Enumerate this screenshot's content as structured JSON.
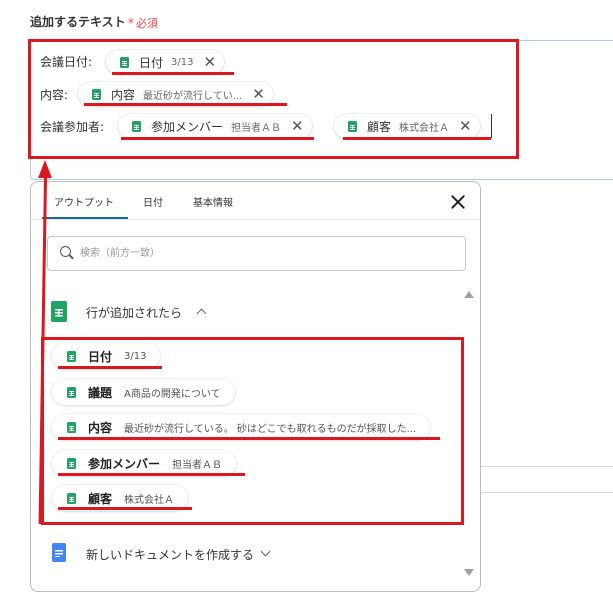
{
  "form": {
    "label": "追加するテキスト",
    "required_mark": "*",
    "required_text": "必須",
    "rows": [
      {
        "label": "会議日付:",
        "chips": [
          {
            "name": "日付",
            "value": "3/13"
          }
        ]
      },
      {
        "label": "内容:",
        "chips": [
          {
            "name": "内容",
            "value": "最近砂が流行してい..."
          }
        ]
      },
      {
        "label": "会議参加者:",
        "chips": [
          {
            "name": "参加メンバー",
            "value": "担当者ＡＢ"
          },
          {
            "name": "顧客",
            "value": "株式会社Ａ"
          }
        ]
      }
    ]
  },
  "panel": {
    "tabs": [
      "アウトプット",
      "日付",
      "基本情報"
    ],
    "active_tab": "アウトプット",
    "search_placeholder": "検索（前方一致）",
    "group": {
      "title": "行が追加されたら",
      "items": [
        {
          "name": "日付",
          "value": "3/13"
        },
        {
          "name": "議題",
          "value": "A商品の開発について"
        },
        {
          "name": "内容",
          "value": "最近砂が流行している。 砂はどこでも取れるものだが採取した..."
        },
        {
          "name": "参加メンバー",
          "value": "担当者ＡＢ"
        },
        {
          "name": "顧客",
          "value": "株式会社Ａ"
        }
      ]
    },
    "next_group": {
      "title": "新しいドキュメントを作成する"
    }
  },
  "colors": {
    "annotation_red": "#d9191f",
    "sheets_green": "#1fa463",
    "docs_blue": "#4285f4",
    "tab_active": "#1a6e8a",
    "required_red": "#e54848"
  },
  "icons": [
    "sheets-icon",
    "docs-icon",
    "close-icon",
    "search-icon",
    "chevron-up-icon",
    "chevron-down-icon"
  ]
}
